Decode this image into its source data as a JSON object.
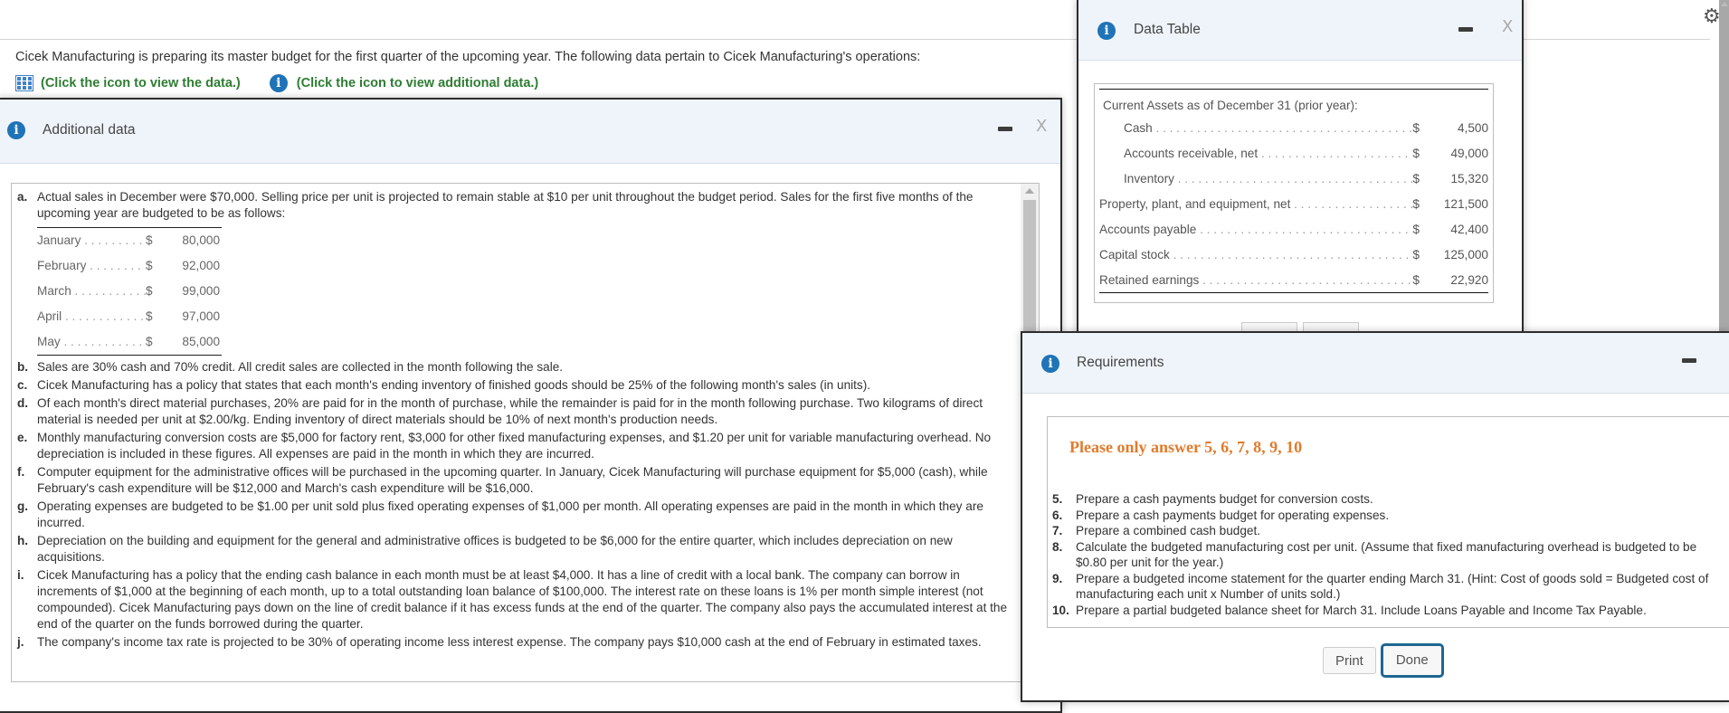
{
  "page": {
    "intro": "Cicek Manufacturing is preparing its master budget for the first quarter of the upcoming year. The following data pertain to Cicek Manufacturing's operations:",
    "link_data": "(Click the icon to view the data.)",
    "link_additional": "(Click the icon to view additional data.)",
    "settings_icon": "gear-icon"
  },
  "additional": {
    "title": "Additional data",
    "minimize_label": "minimize",
    "close_label": "X",
    "item_a": {
      "letter": "a.",
      "text": "Actual sales in December were $70,000. Selling price per unit is projected to remain stable at $10 per unit throughout the budget period. Sales for the first five months of the upcoming year are budgeted to be as follows:"
    },
    "sales": [
      {
        "month": "January",
        "currency": "$",
        "value": "80,000"
      },
      {
        "month": "February",
        "currency": "$",
        "value": "92,000"
      },
      {
        "month": "March",
        "currency": "$",
        "value": "99,000"
      },
      {
        "month": "April",
        "currency": "$",
        "value": "97,000"
      },
      {
        "month": "May",
        "currency": "$",
        "value": "85,000"
      }
    ],
    "items": [
      {
        "letter": "b.",
        "text": "Sales are 30% cash and 70% credit. All credit sales are collected in the month following the sale."
      },
      {
        "letter": "c.",
        "text": "Cicek Manufacturing has a policy that states that each month's ending inventory of finished goods should be 25% of the following month's sales (in units)."
      },
      {
        "letter": "d.",
        "text": "Of each month's direct material purchases, 20% are paid for in the month of purchase, while the remainder is paid for in the month following purchase. Two kilograms of direct material is needed per unit at $2.00/kg. Ending inventory of direct materials should be 10% of next month's production needs."
      },
      {
        "letter": "e.",
        "text": "Monthly manufacturing conversion costs are $5,000 for factory rent, $3,000 for other fixed manufacturing expenses, and $1.20 per unit for variable manufacturing overhead. No depreciation is included in these figures. All expenses are paid in the month in which they are incurred."
      },
      {
        "letter": "f.",
        "text": "Computer equipment for the administrative offices will be purchased in the upcoming quarter. In January, Cicek Manufacturing will purchase equipment for $5,000 (cash), while February's cash expenditure will be $12,000 and March's cash expenditure will be $16,000."
      },
      {
        "letter": "g.",
        "text": "Operating expenses are budgeted to be $1.00 per unit sold plus fixed operating expenses of $1,000 per month. All operating expenses are paid in the month in which they are incurred."
      },
      {
        "letter": "h.",
        "text": "Depreciation on the building and equipment for the general and administrative offices is budgeted to be $6,000 for the entire quarter, which includes depreciation on new acquisitions."
      },
      {
        "letter": "i.",
        "text": "Cicek Manufacturing has a policy that the ending cash balance in each month must be at least $4,000. It has a line of credit with a local bank. The company can borrow in increments of $1,000 at the beginning of each month, up to a total outstanding loan balance of $100,000. The interest rate on these loans is 1% per month simple interest (not compounded). Cicek Manufacturing pays down on the line of credit balance if it has excess funds at the end of the quarter. The company also pays the accumulated interest at the end of the quarter on the funds borrowed during the quarter."
      },
      {
        "letter": "j.",
        "text": "The company's income tax rate is projected to be 30% of operating income less interest expense. The company pays $10,000 cash at the end of February in estimated taxes."
      }
    ]
  },
  "datatable": {
    "title": "Data Table",
    "close_label": "X",
    "caption": "Current Assets as of December 31 (prior year):",
    "rows": [
      {
        "label": "Cash",
        "currency": "$",
        "value": "4,500",
        "indent": true
      },
      {
        "label": "Accounts receivable, net",
        "currency": "$",
        "value": "49,000",
        "indent": true
      },
      {
        "label": "Inventory",
        "currency": "$",
        "value": "15,320",
        "indent": true
      },
      {
        "label": "Property, plant, and equipment, net",
        "currency": "$",
        "value": "121,500",
        "indent": false
      },
      {
        "label": "Accounts payable",
        "currency": "$",
        "value": "42,400",
        "indent": false
      },
      {
        "label": "Capital stock",
        "currency": "$",
        "value": "125,000",
        "indent": false
      },
      {
        "label": "Retained earnings",
        "currency": "$",
        "value": "22,920",
        "indent": false
      }
    ]
  },
  "requirements": {
    "title": "Requirements",
    "note": "Please only answer 5, 6, 7, 8, 9, 10",
    "items": [
      {
        "num": "5.",
        "text": "Prepare a cash payments budget for conversion costs."
      },
      {
        "num": "6.",
        "text": "Prepare a cash payments budget for operating expenses."
      },
      {
        "num": "7.",
        "text": "Prepare a combined cash budget."
      },
      {
        "num": "8.",
        "text": "Calculate the budgeted manufacturing cost per unit. (Assume that fixed manufacturing overhead is budgeted to be $0.80 per unit for the year.)"
      },
      {
        "num": "9.",
        "text": "Prepare a budgeted income statement for the quarter ending March 31. (Hint: Cost of goods sold = Budgeted cost of manufacturing each unit x Number of units sold.)"
      },
      {
        "num": "10.",
        "text": "Prepare a partial budgeted balance sheet for March 31. Include Loans Payable and Income Tax Payable."
      }
    ],
    "print_label": "Print",
    "done_label": "Done"
  },
  "colors": {
    "link_green": "#2e7d32",
    "info_blue": "#1f73b7",
    "note_orange": "#e07b2c",
    "done_border": "#1e6791",
    "header_bg": "#eff4fb"
  }
}
